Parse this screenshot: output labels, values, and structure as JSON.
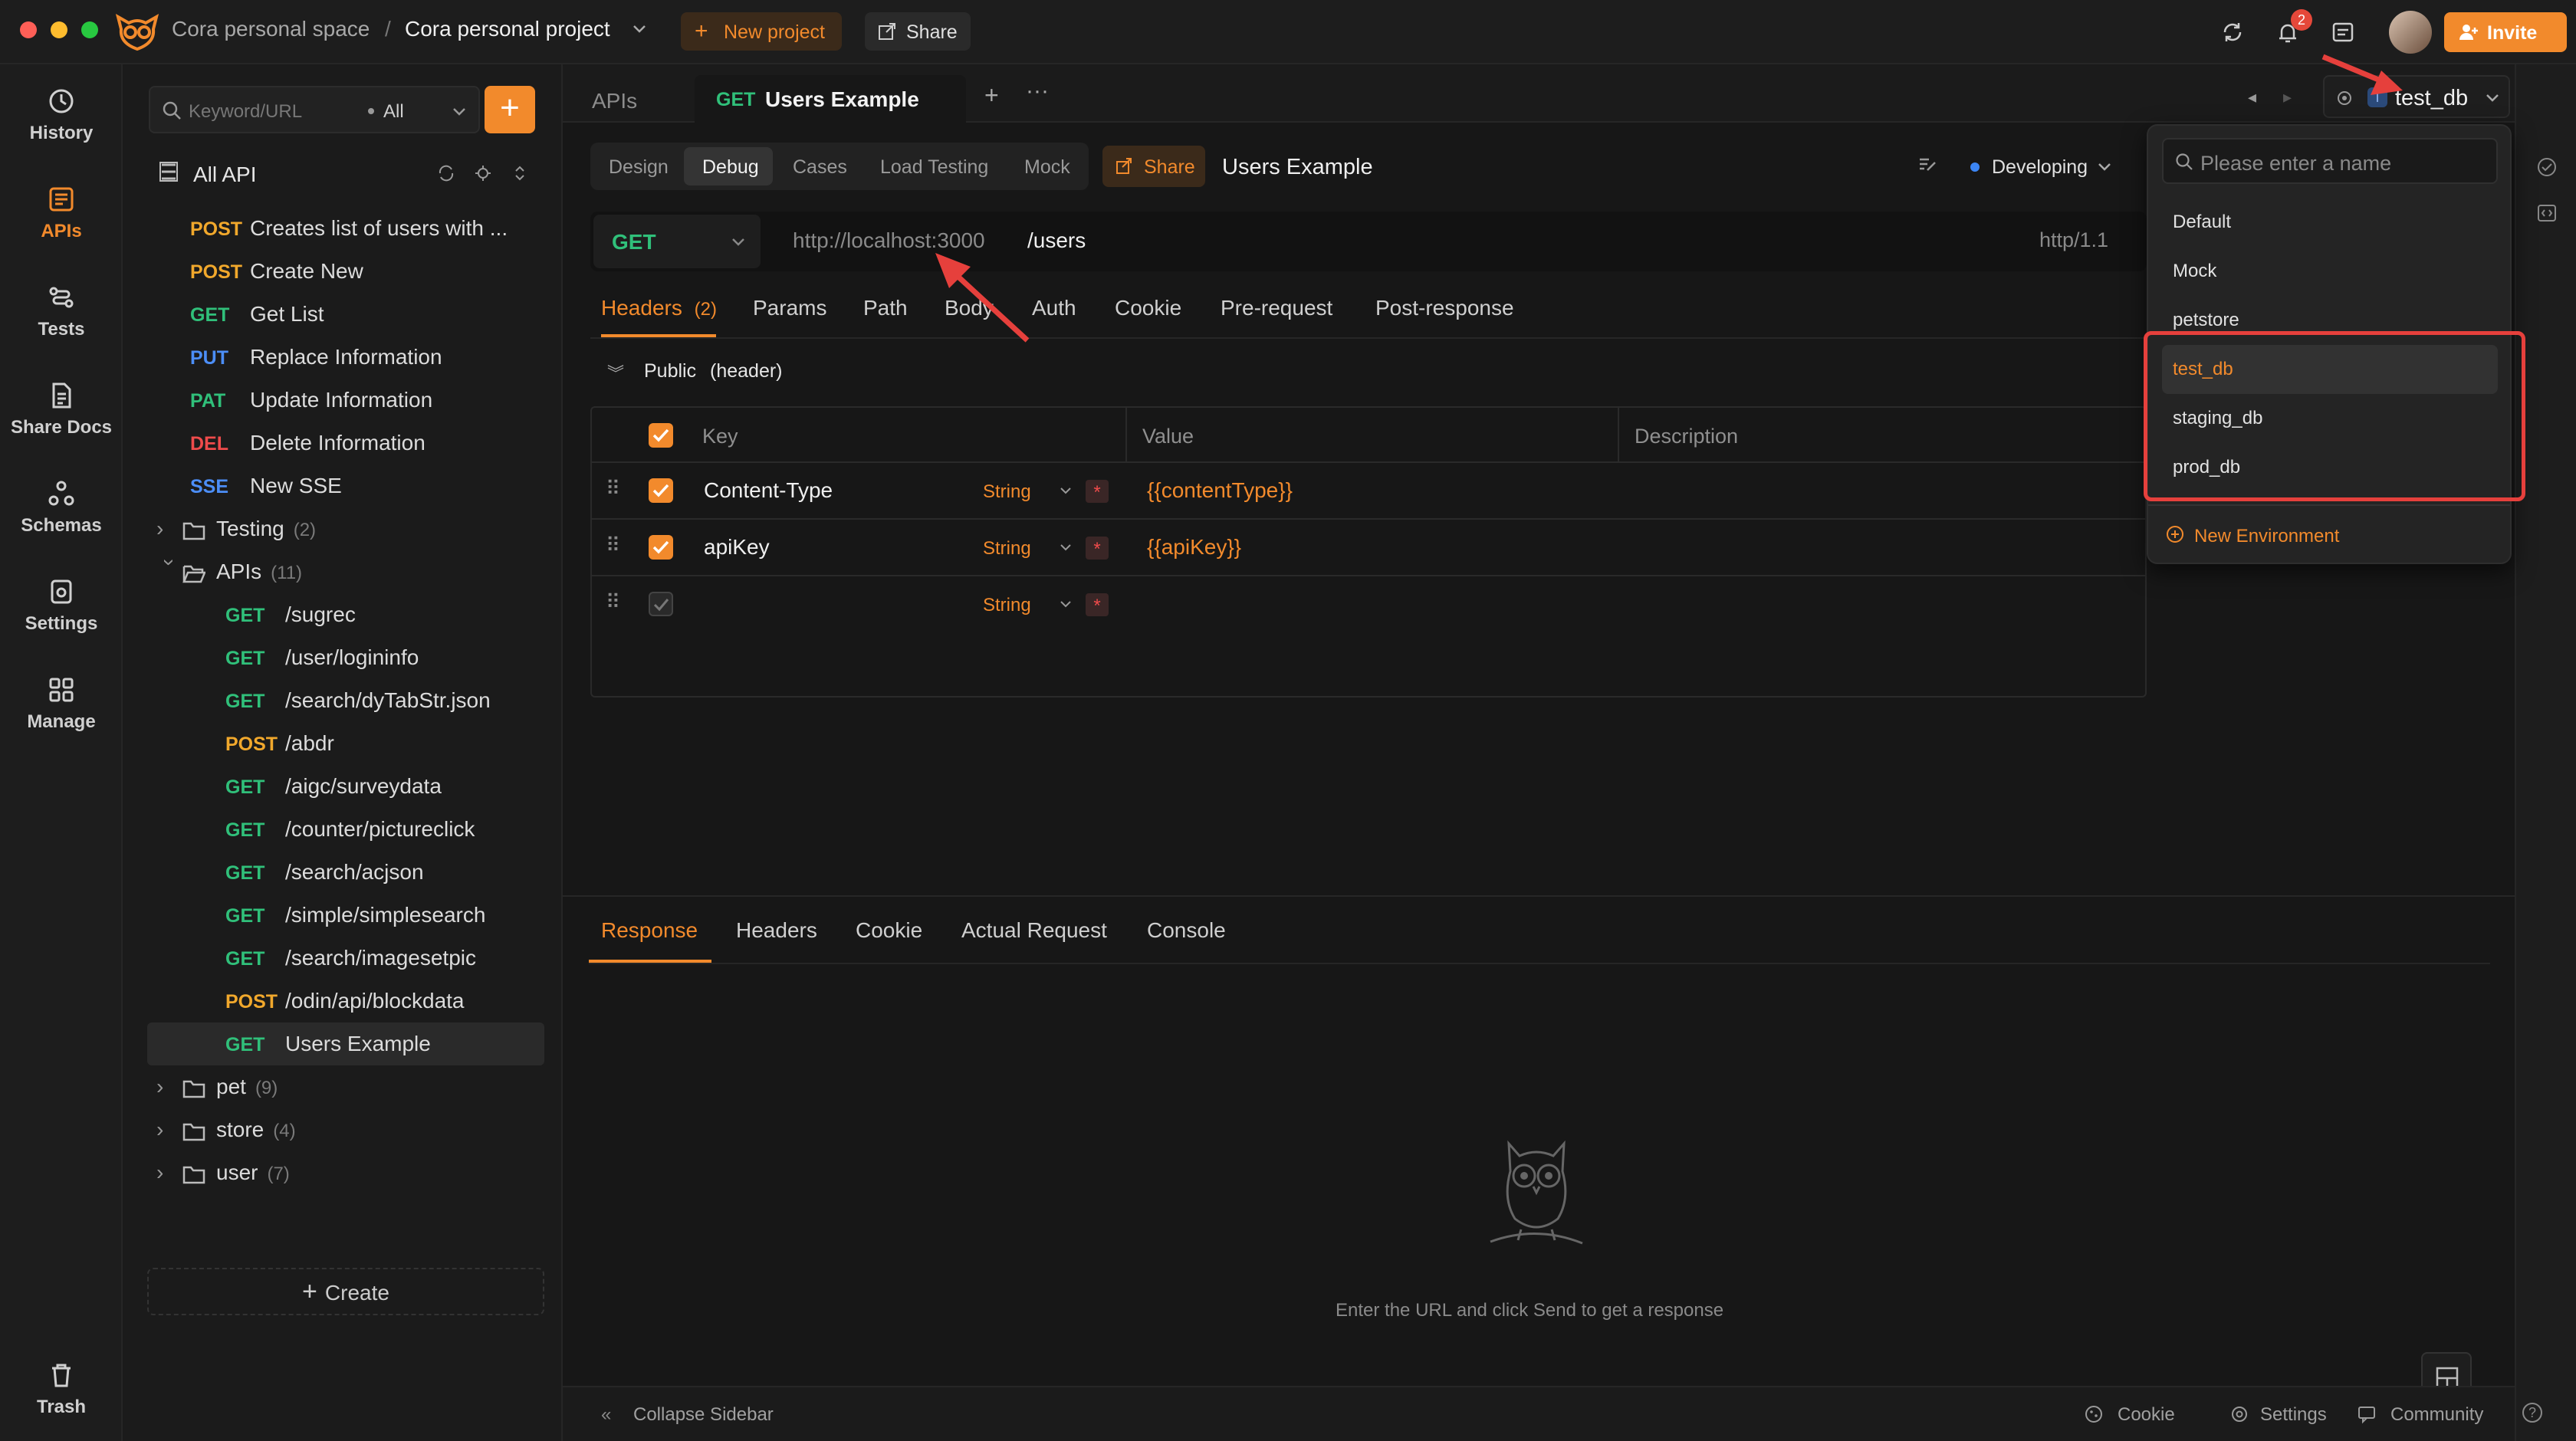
{
  "titlebar": {
    "space": "Cora personal space",
    "separator": "/",
    "project": "Cora personal project",
    "new_project": "New project",
    "share": "Share",
    "notif_count": "2",
    "invite": "Invite"
  },
  "rail": {
    "items": [
      "History",
      "APIs",
      "Tests",
      "Share Docs",
      "Schemas",
      "Settings",
      "Manage"
    ],
    "trash": "Trash"
  },
  "tree": {
    "search_placeholder": "Keyword/URL",
    "filter": "All",
    "all_api": "All API",
    "top_items": [
      {
        "method": "POST",
        "name": "Creates list of users with ..."
      },
      {
        "method": "POST",
        "name": "Create New"
      },
      {
        "method": "GET",
        "name": "Get List"
      },
      {
        "method": "PUT",
        "name": "Replace Information"
      },
      {
        "method": "PAT",
        "name": "Update Information"
      },
      {
        "method": "DEL",
        "name": "Delete Information"
      },
      {
        "method": "SSE",
        "name": "New SSE"
      }
    ],
    "folder_testing": {
      "name": "Testing",
      "count": "(2)"
    },
    "folder_apis": {
      "name": "APIs",
      "count": "(11)"
    },
    "apis_items": [
      {
        "method": "GET",
        "name": "/sugrec"
      },
      {
        "method": "GET",
        "name": "/user/logininfo"
      },
      {
        "method": "GET",
        "name": "/search/dyTabStr.json"
      },
      {
        "method": "POST",
        "name": "/abdr"
      },
      {
        "method": "GET",
        "name": "/aigc/surveydata"
      },
      {
        "method": "GET",
        "name": "/counter/pictureclick"
      },
      {
        "method": "GET",
        "name": "/search/acjson"
      },
      {
        "method": "GET",
        "name": "/simple/simplesearch"
      },
      {
        "method": "GET",
        "name": "/search/imagesetpic"
      },
      {
        "method": "POST",
        "name": "/odin/api/blockdata"
      },
      {
        "method": "GET",
        "name": "Users Example"
      }
    ],
    "folder_pet": {
      "name": "pet",
      "count": "(9)"
    },
    "folder_store": {
      "name": "store",
      "count": "(4)"
    },
    "folder_user": {
      "name": "user",
      "count": "(7)"
    },
    "create": "Create"
  },
  "tabs": {
    "apis": "APIs",
    "active_method": "GET",
    "active_name": "Users Example"
  },
  "env": {
    "current": "test_db",
    "avatar_letter": "T"
  },
  "modes": {
    "items": [
      "Design",
      "Debug",
      "Cases",
      "Load Testing",
      "Mock"
    ],
    "share": "Share",
    "api_name": "Users Example",
    "status": "Developing"
  },
  "request": {
    "method": "GET",
    "base_url": "http://localhost:3000",
    "path": "/users",
    "protocol": "http/1.1"
  },
  "req_tabs": {
    "headers": "Headers",
    "headers_count": "(2)",
    "items": [
      "Params",
      "Path",
      "Body",
      "Auth",
      "Cookie",
      "Pre-request",
      "Post-response"
    ]
  },
  "public_header": {
    "label": "Public",
    "sub": "(header)"
  },
  "table": {
    "cols": [
      "Key",
      "Value",
      "Description"
    ],
    "rows": [
      {
        "key": "Content-Type",
        "type": "String",
        "value": "{{contentType}}"
      },
      {
        "key": "apiKey",
        "type": "String",
        "value": "{{apiKey}}"
      },
      {
        "key": "",
        "type": "String",
        "value": ""
      }
    ]
  },
  "response": {
    "tabs": [
      "Response",
      "Headers",
      "Cookie",
      "Actual Request",
      "Console"
    ],
    "empty": "Enter the URL and click Send to get a response"
  },
  "dropdown": {
    "placeholder": "Please enter a name",
    "items": [
      "Default",
      "Mock",
      "petstore",
      "test_db",
      "staging_db",
      "prod_db"
    ],
    "new_env": "New Environment"
  },
  "footer": {
    "collapse": "Collapse Sidebar",
    "cookie": "Cookie",
    "settings": "Settings",
    "community": "Community"
  },
  "colors": {
    "accent": "#f28a2c",
    "get": "#30c07a",
    "post": "#f1a82c",
    "put": "#4c8ef7",
    "delete": "#ef4b4b",
    "highlight": "#e6403c"
  }
}
